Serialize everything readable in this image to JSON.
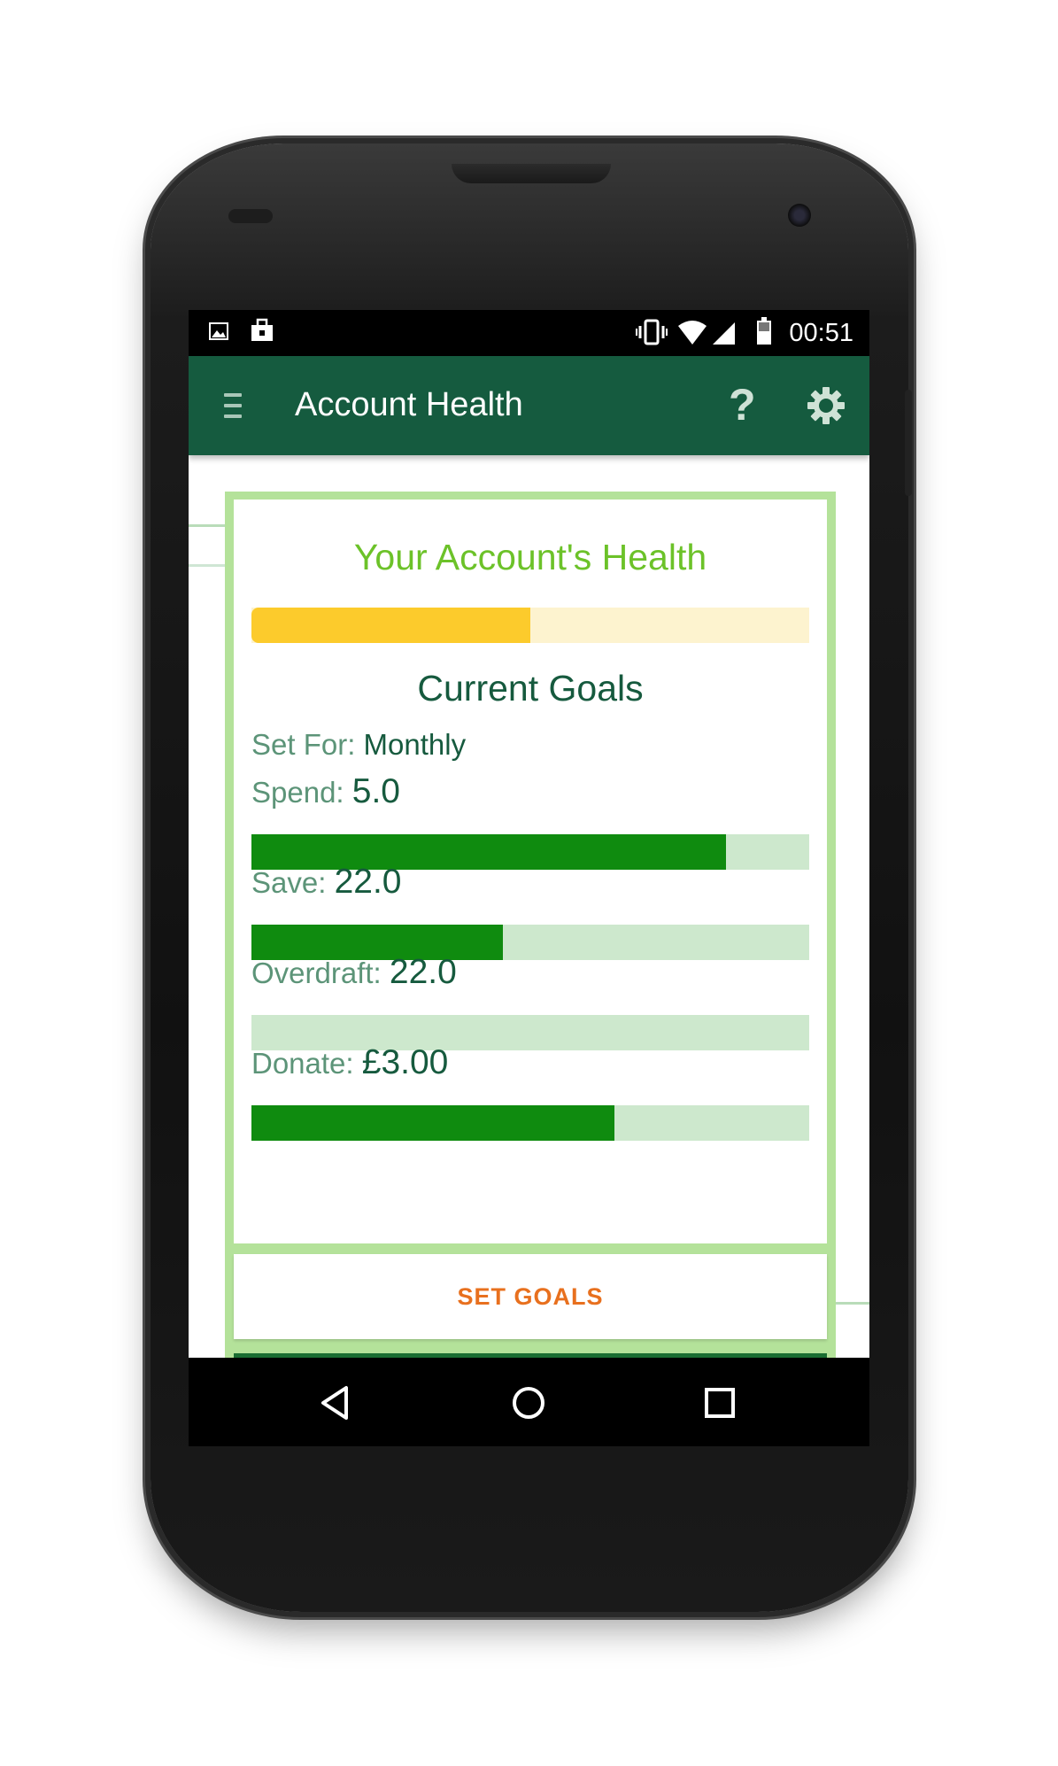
{
  "status_bar": {
    "time": "00:51",
    "left_icons": [
      "image-icon",
      "shopping-bag-icon"
    ],
    "right_icons": [
      "vibrate-icon",
      "wifi-icon",
      "signal-icon",
      "battery-icon"
    ]
  },
  "app_bar": {
    "title": "Account Health",
    "menu_icon": "hamburger-menu-icon",
    "help_label": "?",
    "settings_icon": "gear-icon",
    "background": "#155b3f"
  },
  "health": {
    "title": "Your Account's Health",
    "progress": 0.5,
    "fill_color": "#fccb2c",
    "track_color": "#fdf3cf"
  },
  "goals": {
    "title": "Current Goals",
    "set_for_label": "Set For:",
    "set_for_value": "Monthly",
    "items": [
      {
        "label": "Spend:",
        "value": "5.0",
        "progress": 0.85
      },
      {
        "label": "Save:",
        "value": "22.0",
        "progress": 0.45
      },
      {
        "label": "Overdraft:",
        "value": "22.0",
        "progress": 0.0
      },
      {
        "label": "Donate:",
        "value": "£3.00",
        "progress": 0.65
      }
    ],
    "fill_color": "#0f8b0f",
    "track_color": "#cde8cd"
  },
  "actions": {
    "set_goals_label": "SET GOALS",
    "set_goals_color": "#e8701e"
  },
  "nav_bar": {
    "icons": [
      "back-icon",
      "home-icon",
      "recents-icon"
    ]
  }
}
